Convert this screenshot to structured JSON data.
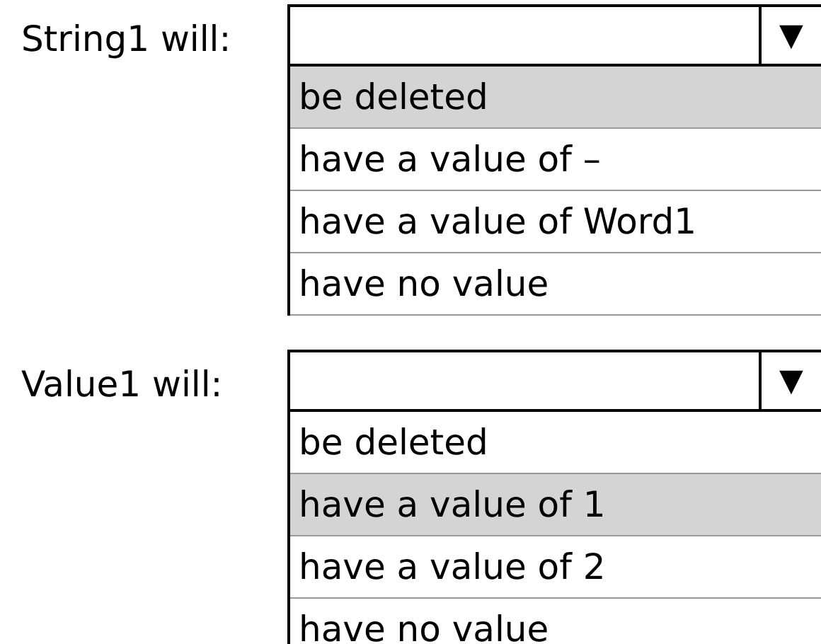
{
  "questions": [
    {
      "label": "String1 will:",
      "arrow": "▼",
      "options": [
        {
          "text": "be deleted",
          "selected": true
        },
        {
          "text": "have a value of –",
          "selected": false
        },
        {
          "text": "have a value of Word1",
          "selected": false
        },
        {
          "text": "have no value",
          "selected": false
        }
      ]
    },
    {
      "label": "Value1 will:",
      "arrow": "▼",
      "options": [
        {
          "text": "be deleted",
          "selected": false
        },
        {
          "text": "have a value of 1",
          "selected": true
        },
        {
          "text": "have a value of 2",
          "selected": false
        },
        {
          "text": "have no value",
          "selected": false
        }
      ]
    }
  ]
}
